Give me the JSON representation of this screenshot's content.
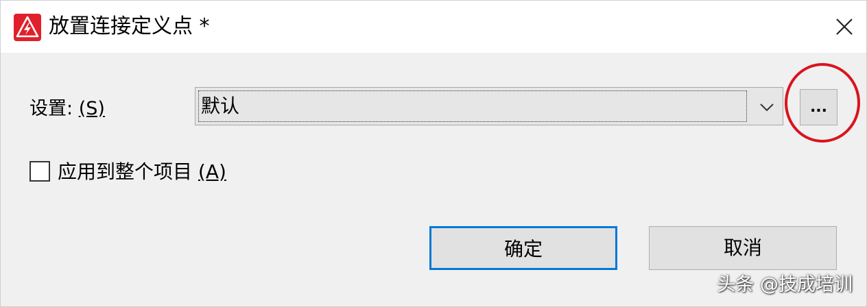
{
  "window": {
    "title": "放置连接定义点 *",
    "icon": "lightning-warning-icon",
    "close_icon": "close-icon"
  },
  "settings": {
    "label": "设置: ",
    "accelerator": "(S)",
    "selected_value": "默认",
    "dropdown_icon": "chevron-down-icon",
    "browse_label": "..."
  },
  "apply_all": {
    "label": "应用到整个项目 ",
    "accelerator": "(A)",
    "checked": false
  },
  "buttons": {
    "ok_label": "确定",
    "cancel_label": "取消"
  },
  "watermark": {
    "text": "头条 @技成培训"
  },
  "colors": {
    "accent": "#0078d7",
    "app_icon_red": "#e0202a",
    "highlight_ring": "#d9141e"
  }
}
